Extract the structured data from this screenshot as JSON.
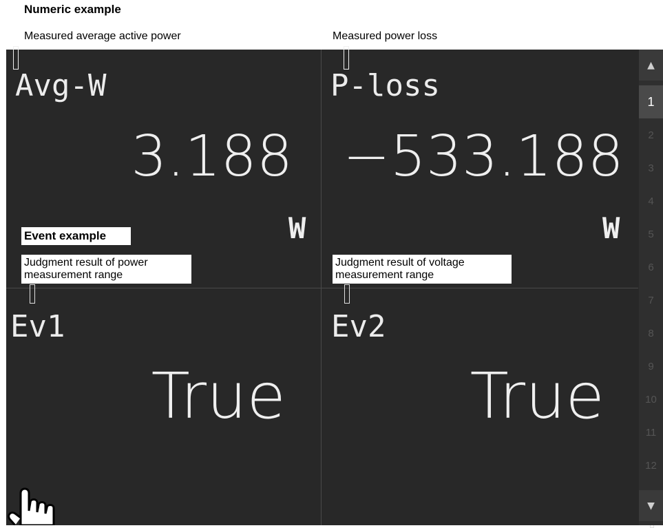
{
  "annotations": {
    "heading": "Numeric example",
    "avg_w_callout": "Measured average active power",
    "p_loss_callout": "Measured power loss",
    "event_heading": "Event example",
    "ev1_callout": "Judgment result of power measurement range",
    "ev2_callout": "Judgment result of voltage measurement range"
  },
  "panels": [
    {
      "label": "Avg-W",
      "value": "3.188",
      "unit": "W"
    },
    {
      "label": "P-loss",
      "value": "−533.188",
      "unit": "W"
    },
    {
      "label": "Ev1",
      "value": "True"
    },
    {
      "label": "Ev2",
      "value": "True"
    }
  ],
  "sidebar": {
    "pages": [
      "1",
      "2",
      "3",
      "4",
      "5",
      "6",
      "7",
      "8",
      "9",
      "10",
      "11",
      "12"
    ],
    "active_page": 1,
    "up_icon": "triangle-up-icon",
    "down_icon": "triangle-down-icon"
  },
  "gesture": {
    "icon": "hand-pointer-icon"
  }
}
